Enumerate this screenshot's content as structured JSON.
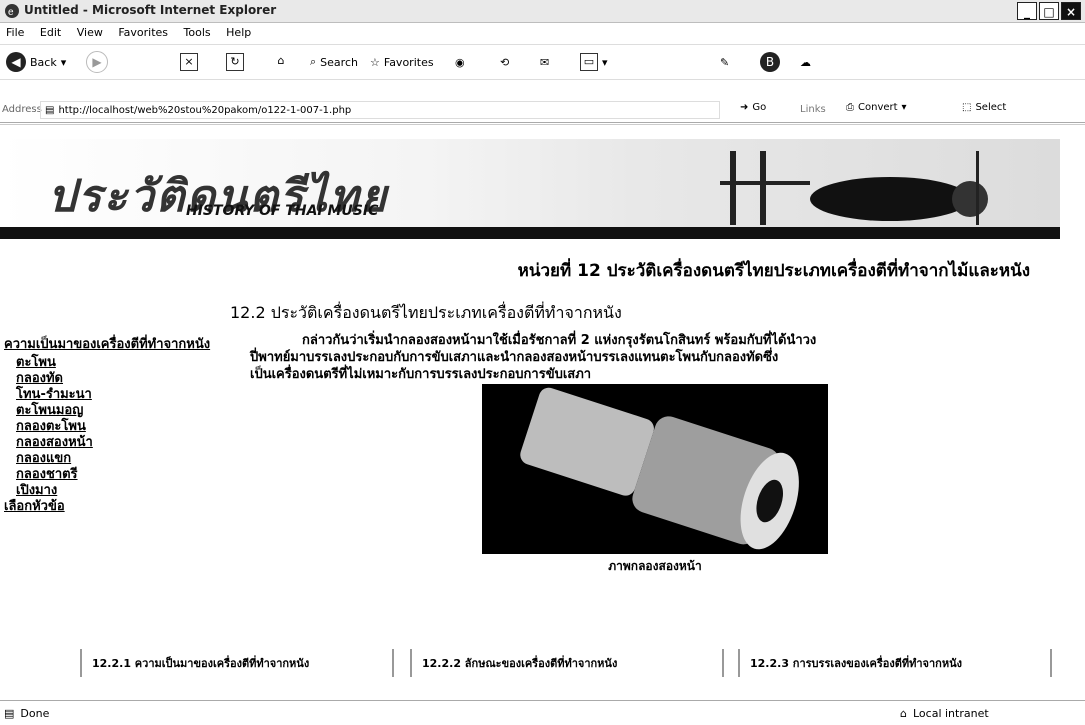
{
  "window": {
    "title": "Untitled - Microsoft Internet Explorer"
  },
  "menu": [
    "File",
    "Edit",
    "View",
    "Favorites",
    "Tools",
    "Help"
  ],
  "toolbar": {
    "back": "Back",
    "search": "Search",
    "favorites": "Favorites"
  },
  "address": {
    "label": "Address",
    "url": "http://localhost/web%20stou%20pakom/o122-1-007-1.php",
    "go": "Go",
    "links": "Links",
    "convert": "Convert",
    "select": "Select"
  },
  "banner": {
    "thai_title": "ประวัติดนตรีไทย",
    "eng_title": "HISTORY OF THAI MUSIC"
  },
  "headings": {
    "unit": "หน่วยที่ 12 ประวัติเครื่องดนตรีไทยประเภทเครื่องตีที่ทำจากไม้และหนัง",
    "section": "12.2 ประวัติเครื่องดนตรีไทยประเภทเครื่องตีที่ทำจากหนัง"
  },
  "sidebar": {
    "top": "ความเป็นมาของเครื่องตีที่ทำจากหนัง",
    "items": [
      "ตะโพน",
      "กลองทัด",
      "โทน-รำมะนา",
      "ตะโพนมอญ",
      "กลองตะโพน",
      "กลองสองหน้า",
      "กลองแขก",
      "กลองชาตรี",
      "เปิงมาง"
    ],
    "bottom": "เลือกหัวข้อ"
  },
  "main": {
    "paragraph_lines": [
      "กล่าวกันว่าเริ่มนำกลองสองหน้ามาใช้เมื่อรัชกาลที่ 2 แห่งกรุงรัตนโกสินทร์ พร้อมกับที่ได้นำวง",
      "ปี่พาทย์มาบรรเลงประกอบกับการขับเสภาและนำกลองสองหน้าบรรเลงแทนตะโพนกับกลองทัดซึ่ง",
      "เป็นเครื่องดนตรีที่ไม่เหมาะกับการบรรเลงประกอบการขับเสภา"
    ],
    "image_caption": "ภาพกลองสองหน้า"
  },
  "subnav": [
    "12.2.1 ความเป็นมาของเครื่องตีที่ทำจากหนัง",
    "12.2.2 ลักษณะของเครื่องตีที่ทำจากหนัง",
    "12.2.3 การบรรเลงของเครื่องตีที่ทำจากหนัง"
  ],
  "status": {
    "left": "Done",
    "right": "Local intranet"
  }
}
